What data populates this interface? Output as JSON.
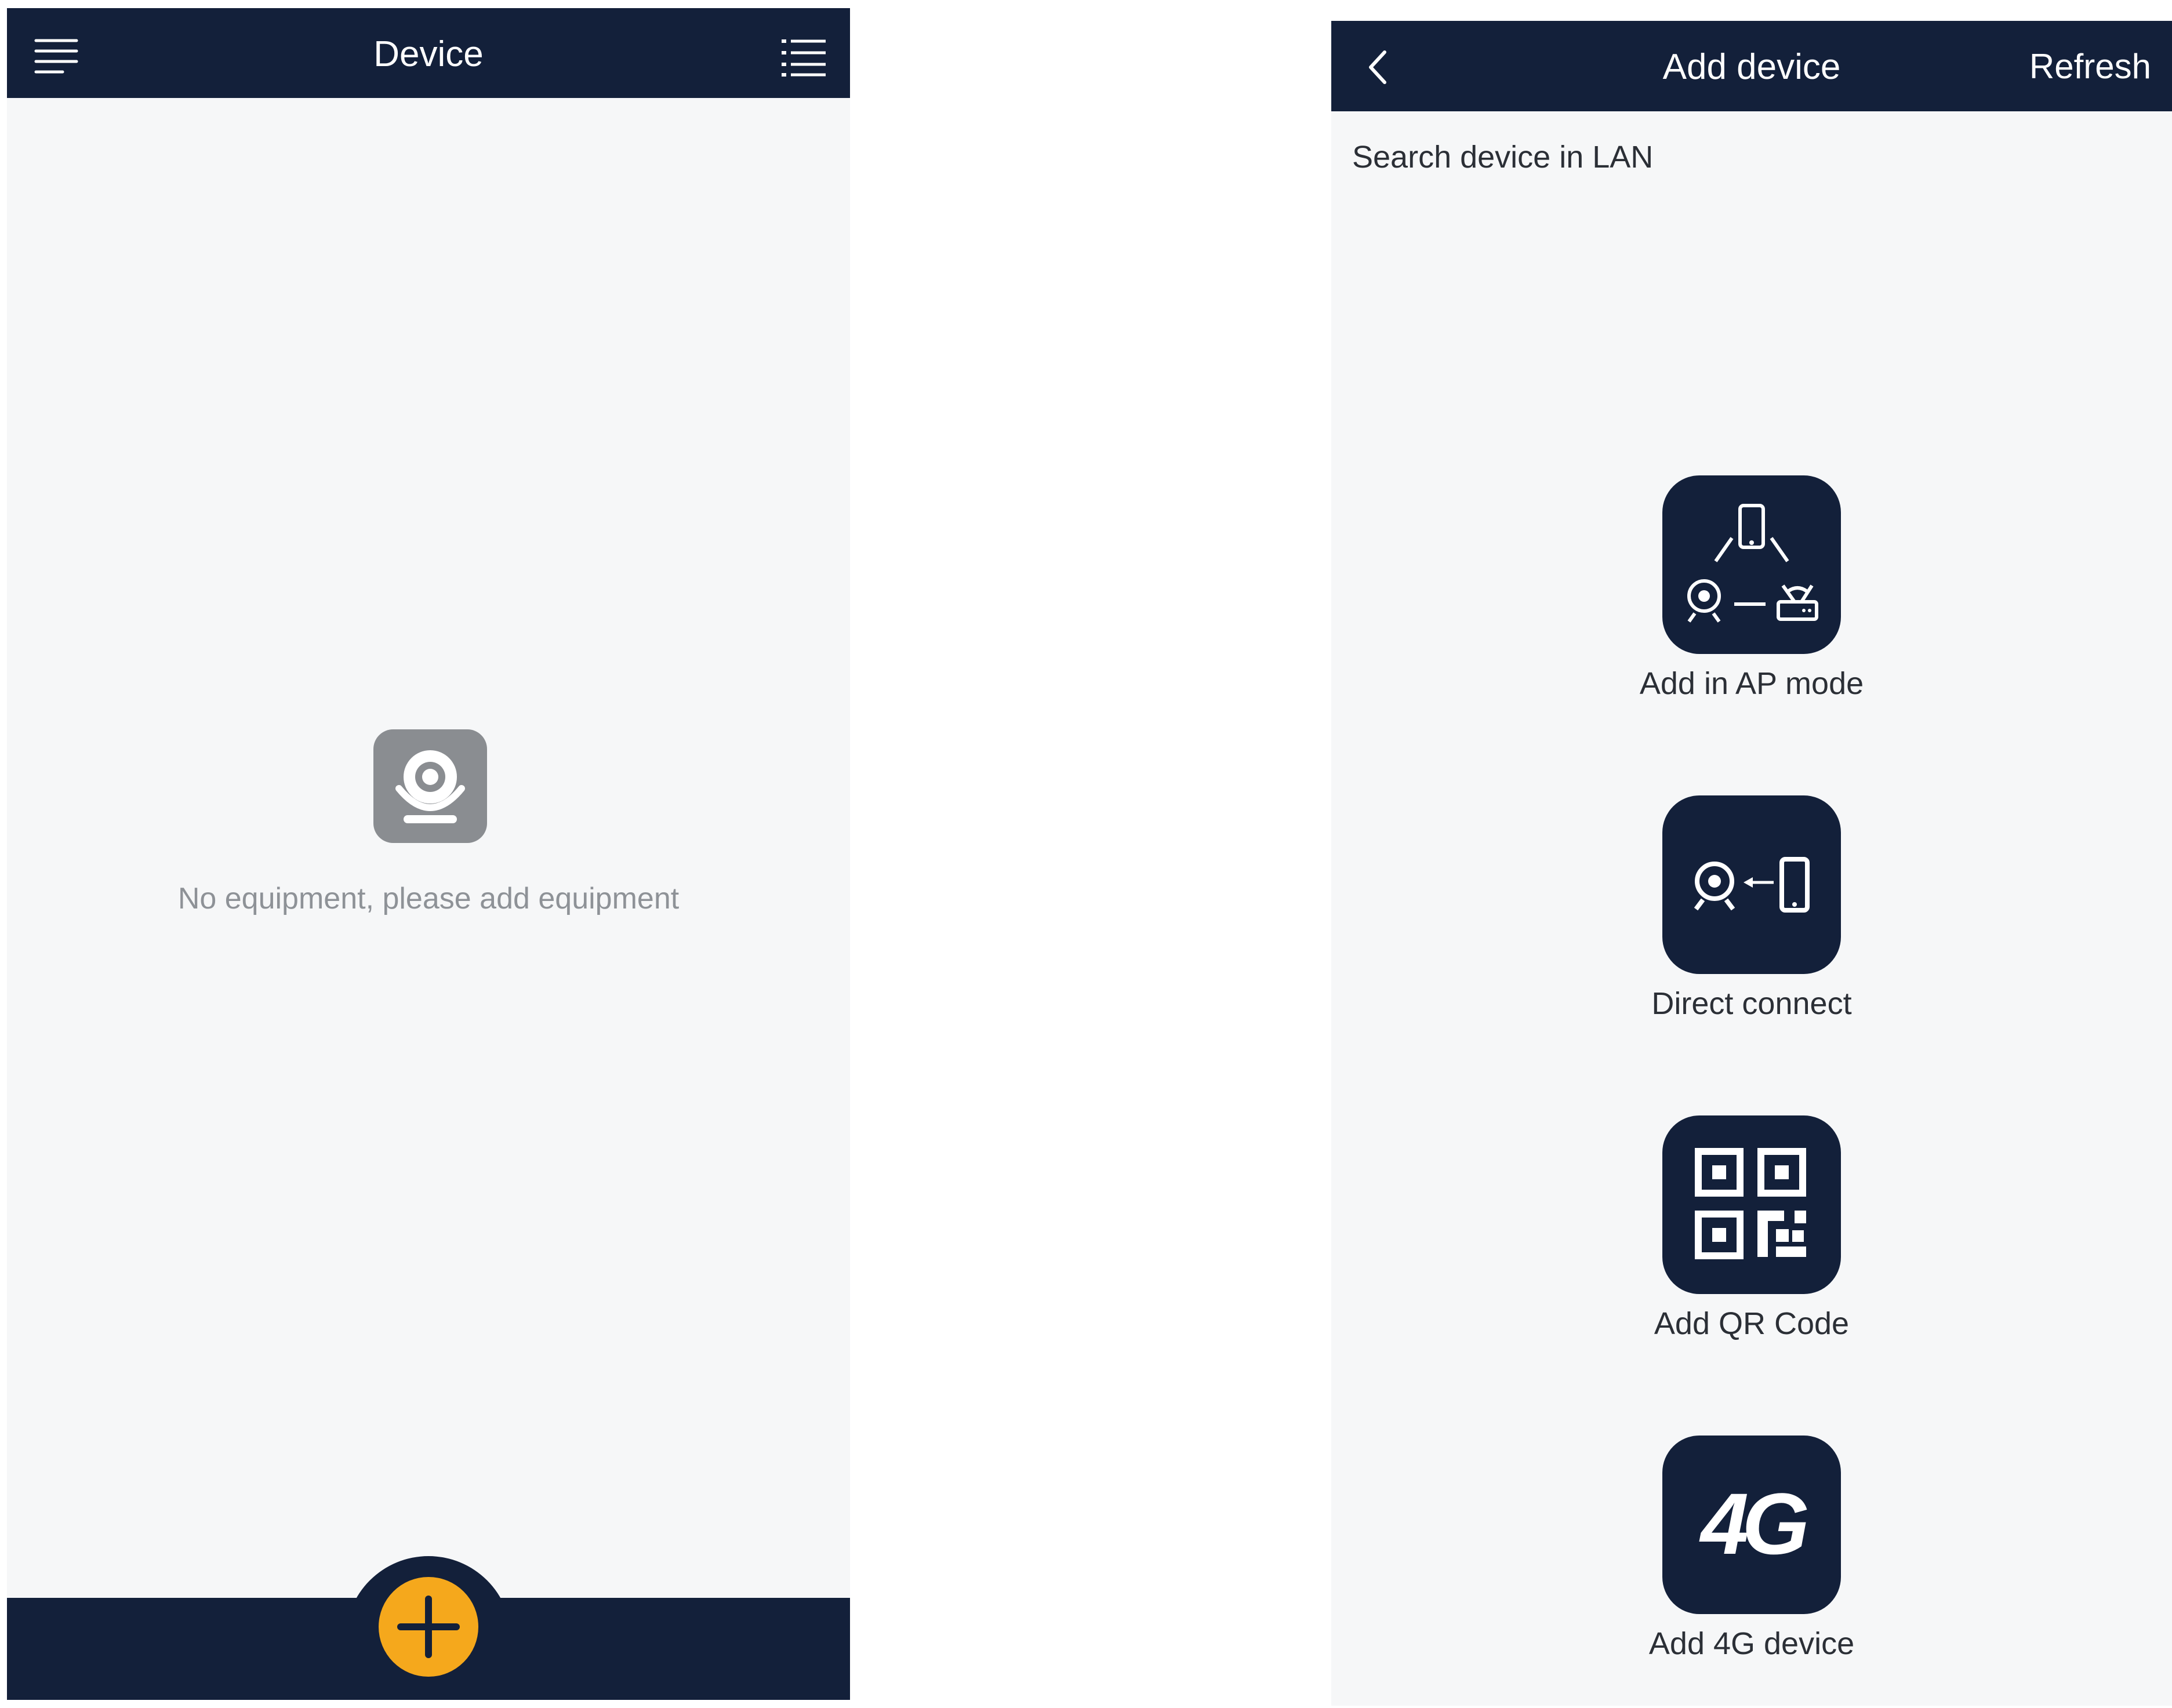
{
  "left_screen": {
    "title": "Device",
    "empty_message": "No equipment, please add equipment"
  },
  "right_screen": {
    "title": "Add device",
    "refresh_label": "Refresh",
    "section_label": "Search device in LAN",
    "options": [
      {
        "label": "Add in AP mode",
        "icon": "ap-mode-icon"
      },
      {
        "label": "Direct connect",
        "icon": "direct-connect-icon"
      },
      {
        "label": "Add QR Code",
        "icon": "qr-code-icon"
      },
      {
        "label": "Add 4G device",
        "icon": "4g-icon",
        "icon_text": "4G"
      }
    ]
  },
  "colors": {
    "navbar": "#13203a",
    "background": "#f6f7f8",
    "fab": "#f5a81c",
    "empty_icon": "#8a8d91"
  }
}
